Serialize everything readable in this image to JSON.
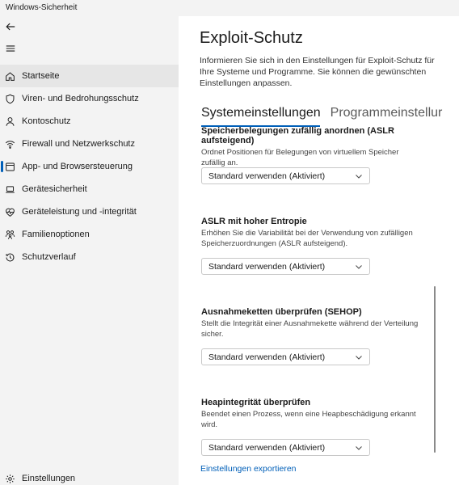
{
  "window": {
    "title": "Windows-Sicherheit"
  },
  "sidebar": {
    "items": [
      {
        "label": "Startseite",
        "icon": "home-icon"
      },
      {
        "label": "Viren- und Bedrohungsschutz",
        "icon": "shield-icon"
      },
      {
        "label": "Kontoschutz",
        "icon": "person-icon"
      },
      {
        "label": "Firewall und Netzwerkschutz",
        "icon": "wifi-icon"
      },
      {
        "label": "App- und Browsersteuerung",
        "icon": "app-window-icon"
      },
      {
        "label": "Gerätesicherheit",
        "icon": "laptop-icon"
      },
      {
        "label": "Geräteleistung und -integrität",
        "icon": "heart-pulse-icon"
      },
      {
        "label": "Familienoptionen",
        "icon": "family-icon"
      },
      {
        "label": "Schutzverlauf",
        "icon": "history-icon"
      }
    ],
    "settings_label": "Einstellungen"
  },
  "main": {
    "title": "Exploit-Schutz",
    "description": "Informieren Sie sich in den Einstellungen für Exploit-Schutz für Ihre Systeme und Programme. Sie können die gewünschten Einstellungen anpassen.",
    "tabs": [
      {
        "label": "Systemeinstellungen"
      },
      {
        "label": "Programmeinstellur"
      }
    ],
    "sections": [
      {
        "title": "Speicherbelegungen zufällig anordnen (ASLR aufsteigend)",
        "description": "Ordnet Positionen für Belegungen von virtuellem Speicher zufällig an.",
        "value": "Standard verwenden (Aktiviert)"
      },
      {
        "title": "ASLR mit hoher Entropie",
        "description": "Erhöhen Sie die Variabilität bei der Verwendung von zufälligen Speicherzuordnungen (ASLR aufsteigend).",
        "value": "Standard verwenden (Aktiviert)"
      },
      {
        "title": "Ausnahmeketten überprüfen (SEHOP)",
        "description": "Stellt die Integrität einer Ausnahmekette während der Verteilung sicher.",
        "value": "Standard verwenden (Aktiviert)"
      },
      {
        "title": "Heapintegrität überprüfen",
        "description": "Beendet einen Prozess, wenn eine Heapbeschädigung erkannt wird.",
        "value": "Standard verwenden (Aktiviert)"
      }
    ],
    "export_link": "Einstellungen exportieren"
  },
  "colors": {
    "accent": "#005fb8",
    "sidebar_bg": "#f3f3f3",
    "active_bg": "#e6e6e6"
  }
}
